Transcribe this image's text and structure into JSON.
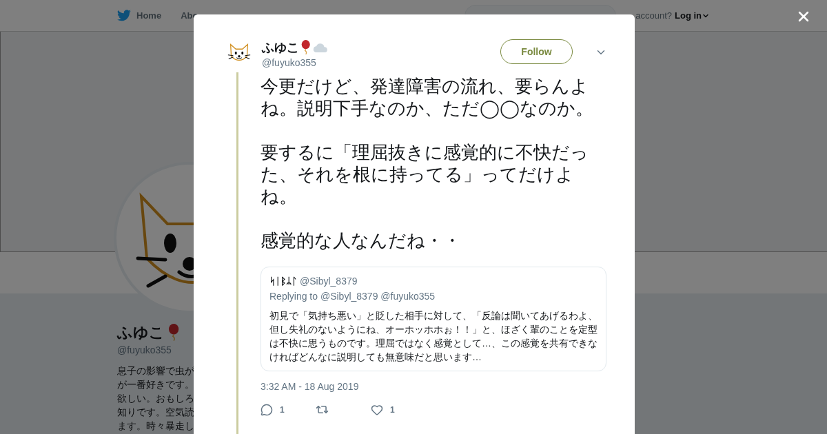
{
  "header": {
    "nav": [
      {
        "label": "Home",
        "kind": "home"
      },
      {
        "label": "Abo",
        "kind": "plain"
      }
    ],
    "account_prompt": "account?",
    "login": "Log in"
  },
  "profile": {
    "name": "ふゆこ",
    "handle": "@fuyuko355",
    "bio_lines": [
      "息子の影響で虫が",
      "が一番好きです。",
      "欲しい。おもしろ",
      "知りです。空気読",
      "ます。時々暴走し"
    ]
  },
  "tweet": {
    "name": "ふゆこ",
    "handle": "@fuyuko355",
    "follow": "Follow",
    "paragraphs": [
      "今更だけど、発達障害の流れ、要らんよね。説明下手なのか、ただ◯◯なのか。",
      "要するに「理屈抜きに感覚的に不快だった、それを根に持ってる」ってだけよね。",
      "感覚的な人なんだね・・"
    ],
    "quote": {
      "name": "ᛋᛁᛒᛦᛚ",
      "handle": "@Sibyl_8379",
      "replying": "Replying to @Sibyl_8379 @fuyuko355",
      "text": "初見で「気持ち悪い」と貶した相手に対して、「反論は聞いてあげるわよ、但し失礼のないようにね、オーホッホホぉ！！」と、ほざく輩のことを定型は不快に思うものです。理屈ではなく感覚として…、この感覚を共有できなければどんなに説明しても無意味だと思います…"
    },
    "timestamp": "3:32 AM - 18 Aug 2019",
    "actions": [
      {
        "kind": "reply",
        "count": "1"
      },
      {
        "kind": "retweet"
      },
      {
        "kind": "like",
        "count": "1"
      }
    ]
  }
}
